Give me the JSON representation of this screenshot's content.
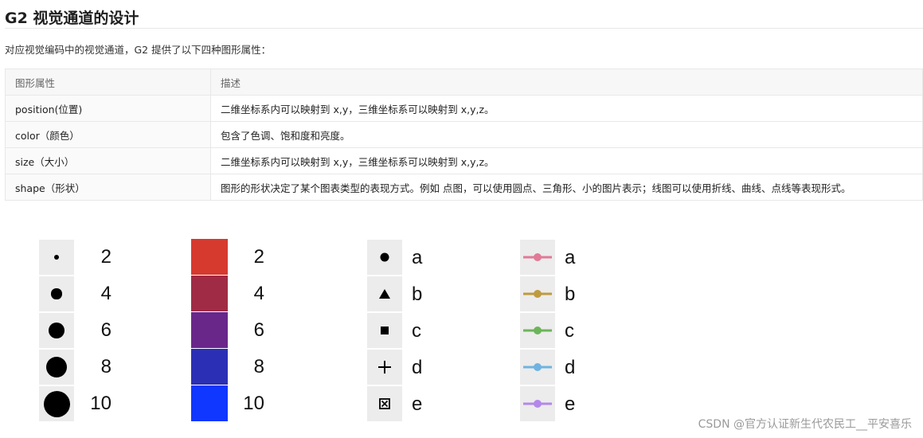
{
  "heading": "G2 视觉通道的设计",
  "intro": "对应视觉编码中的视觉通道，G2 提供了以下四种图形属性：",
  "table": {
    "headers": [
      "图形属性",
      "描述"
    ],
    "rows": [
      {
        "attr": "position(位置)",
        "desc": "二维坐标系内可以映射到 x,y，三维坐标系可以映射到 x,y,z。"
      },
      {
        "attr": "color（颜色）",
        "desc": "包含了色调、饱和度和亮度。"
      },
      {
        "attr": "size（大小）",
        "desc": "二维坐标系内可以映射到 x,y，三维坐标系可以映射到 x,y,z。"
      },
      {
        "attr": "shape（形状）",
        "desc": "图形的形状决定了某个图表类型的表现方式。例如 点图，可以使用圆点、三角形、小的图片表示；线图可以使用折线、曲线、点线等表现形式。"
      }
    ]
  },
  "legends": {
    "size": {
      "labels": [
        "2",
        "4",
        "6",
        "8",
        "10"
      ],
      "values": [
        2,
        4,
        6,
        8,
        10
      ]
    },
    "color": {
      "labels": [
        "2",
        "4",
        "6",
        "8",
        "10"
      ],
      "colors": [
        "#d63a2f",
        "#a02b44",
        "#6a278a",
        "#2b2fb5",
        "#0f37ff"
      ]
    },
    "shape": {
      "labels": [
        "a",
        "b",
        "c",
        "d",
        "e"
      ],
      "icons": [
        "circle-icon",
        "triangle-icon",
        "square-icon",
        "plus-icon",
        "boxed-x-icon"
      ]
    },
    "line": {
      "labels": [
        "a",
        "b",
        "c",
        "d",
        "e"
      ],
      "colors": [
        "#e07a97",
        "#bf9b3f",
        "#6cb45a",
        "#6fb4e0",
        "#b487ea"
      ]
    }
  },
  "watermark": "CSDN @官方认证新生代农民工__平安喜乐"
}
